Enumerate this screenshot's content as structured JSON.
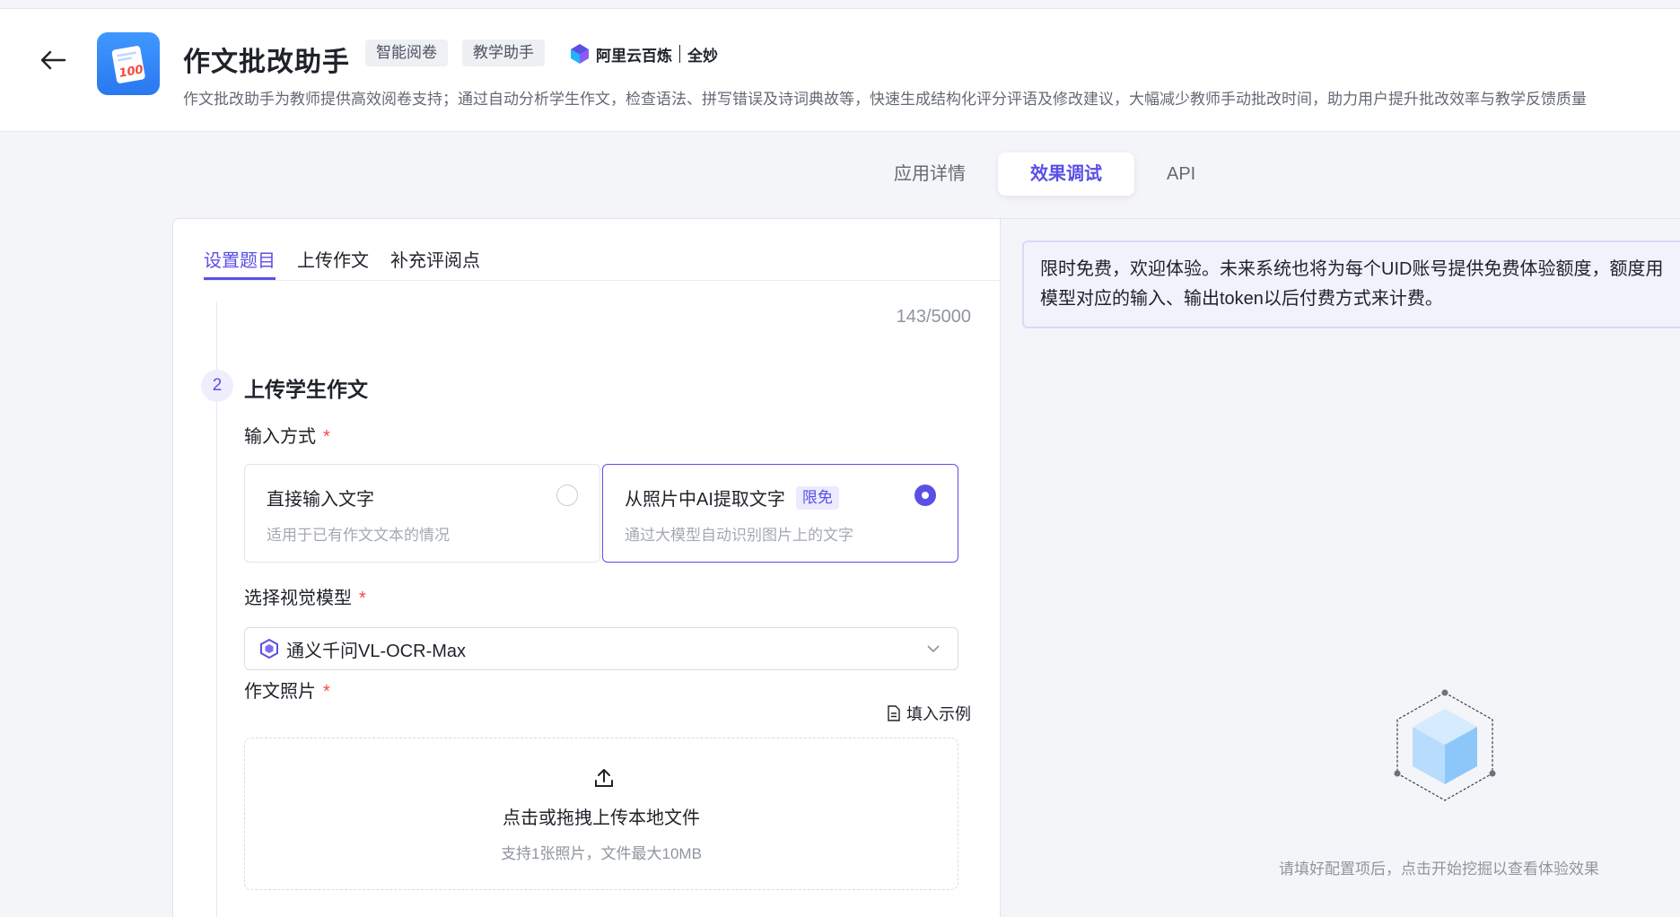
{
  "header": {
    "title": "作文批改助手",
    "tags": [
      "智能阅卷",
      "教学助手"
    ],
    "brand": {
      "name": "阿里云百炼",
      "partner": "全妙"
    },
    "description": "作文批改助手为教师提供高效阅卷支持；通过自动分析学生作文，检查语法、拼写错误及诗词典故等，快速生成结构化评分评语及修改建议，大幅减少教师手动批改时间，助力用户提升批改效率与教学反馈质量",
    "icon_text": "100"
  },
  "main_tabs": [
    {
      "label": "应用详情",
      "active": false
    },
    {
      "label": "效果调试",
      "active": true
    },
    {
      "label": "API",
      "active": false
    }
  ],
  "left": {
    "sub_tabs": [
      {
        "label": "设置题目",
        "active": true
      },
      {
        "label": "上传作文",
        "active": false
      },
      {
        "label": "补充评阅点",
        "active": false
      }
    ],
    "char_count": "143/5000",
    "step": {
      "number": "2",
      "title": "上传学生作文"
    },
    "input_mode": {
      "label": "输入方式",
      "required_mark": "*",
      "options": [
        {
          "title": "直接输入文字",
          "desc": "适用于已有作文文本的情况",
          "selected": false
        },
        {
          "title": "从照片中AI提取文字",
          "badge": "限免",
          "desc": "通过大模型自动识别图片上的文字",
          "selected": true
        }
      ]
    },
    "vision_model": {
      "label": "选择视觉模型",
      "required_mark": "*",
      "value": "通义千问VL-OCR-Max"
    },
    "photo": {
      "label": "作文照片",
      "required_mark": "*",
      "fill_example": "填入示例",
      "upload_main": "点击或拖拽上传本地文件",
      "upload_sub": "支持1张照片，文件最大10MB"
    }
  },
  "right": {
    "notice_line1": "限时免费，欢迎体验。未来系统也将为每个UID账号提供免费体验额度，额度用",
    "notice_line2": "模型对应的输入、输出token以后付费方式来计费。",
    "empty_hint": "请填好配置项后，点击开始挖掘以查看体验效果"
  },
  "colors": {
    "accent": "#5b4fe6",
    "required": "#f54a45",
    "app_icon": "#2f86f6"
  }
}
